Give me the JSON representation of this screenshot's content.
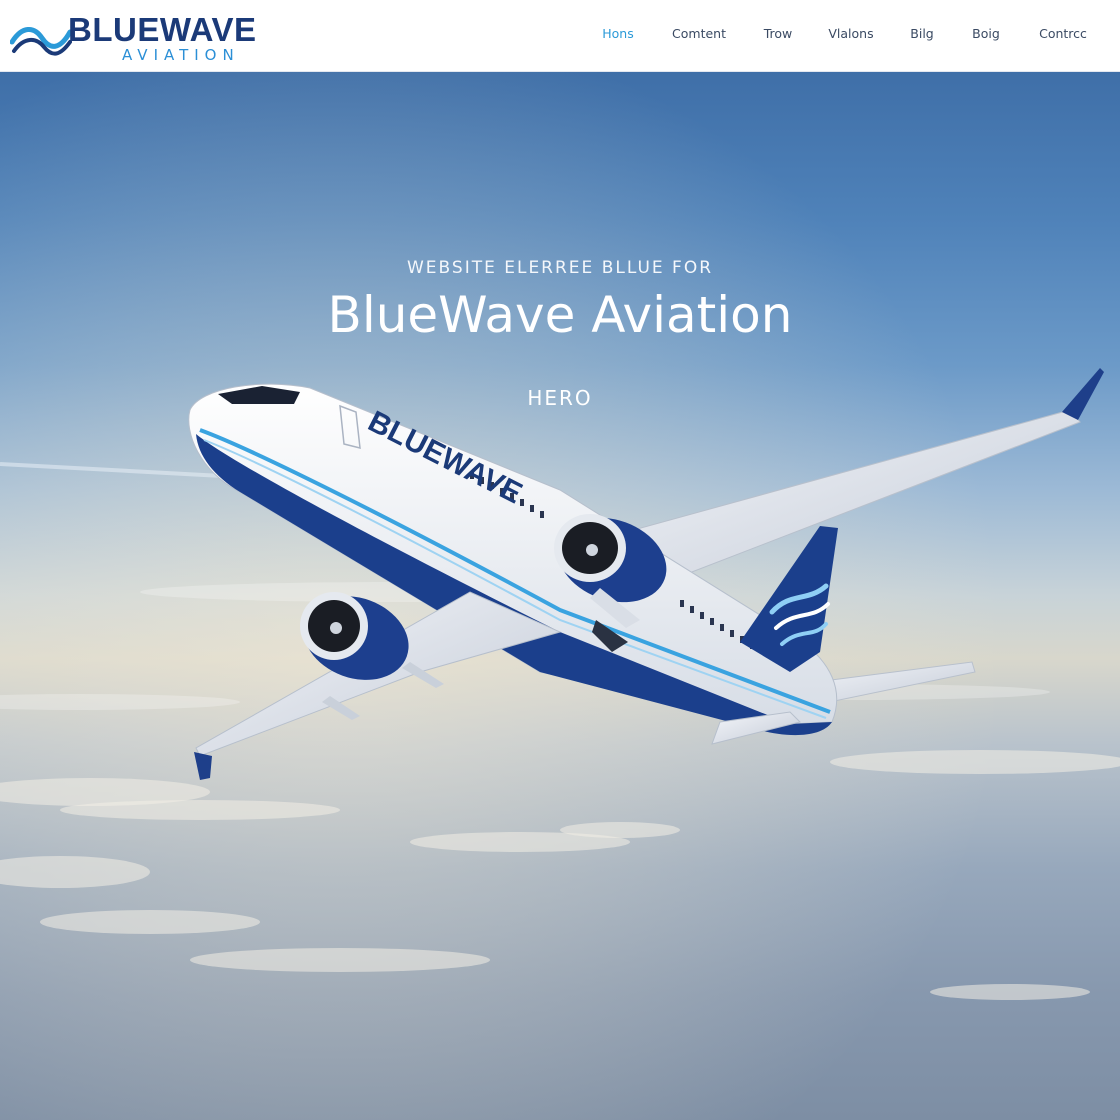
{
  "brand": {
    "name": "BLUEWAVE",
    "sub": "AVIATION",
    "primary_color": "#1b3a78",
    "accent_color": "#2b9ad8"
  },
  "nav": {
    "items": [
      {
        "label": "Hons",
        "active": true
      },
      {
        "label": "Comtent",
        "active": false
      },
      {
        "label": "Trow",
        "active": false
      },
      {
        "label": "Vlalons",
        "active": false
      },
      {
        "label": "Bilg",
        "active": false
      },
      {
        "label": "Boig",
        "active": false
      },
      {
        "label": "Contrcc",
        "active": false
      }
    ]
  },
  "hero": {
    "eyebrow": "WEBSITE ELERREE BLLUE FOR",
    "headline": "BlueWave Aviation",
    "tag": "HERO",
    "aircraft_livery_text": "BLUEWAVE"
  }
}
